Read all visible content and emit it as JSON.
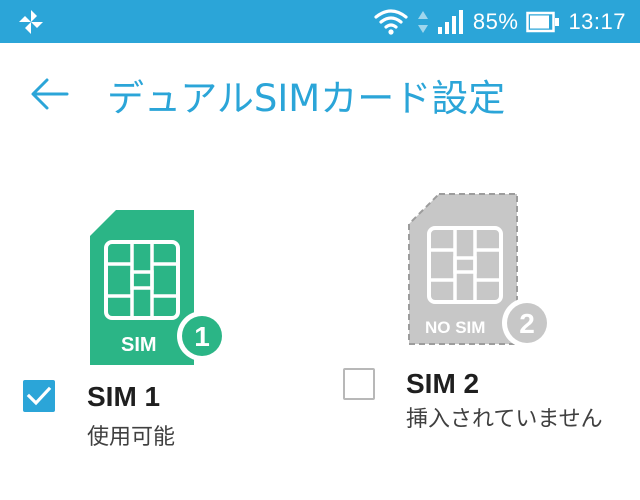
{
  "status_bar": {
    "left_icon": "pinwheel-icon",
    "wifi_icon": "wifi-icon",
    "signal_icon": "cell-signal-icon",
    "battery_percent": "85%",
    "battery_icon": "battery-icon",
    "time": "13:17",
    "background_color": "#2ba5d8"
  },
  "app_bar": {
    "back_icon": "back-arrow-icon",
    "title": "デュアルSIMカード設定",
    "accent_color": "#2ba5d8"
  },
  "sims": [
    {
      "card_label": "SIM",
      "slot_number": "1",
      "name": "SIM 1",
      "status": "使用可能",
      "checked": true,
      "inserted": true,
      "card_color": "#2bb586"
    },
    {
      "card_label": "NO SIM",
      "slot_number": "2",
      "name": "SIM 2",
      "status": "挿入されていません",
      "checked": false,
      "inserted": false,
      "card_color": "#c7c7c7"
    }
  ]
}
